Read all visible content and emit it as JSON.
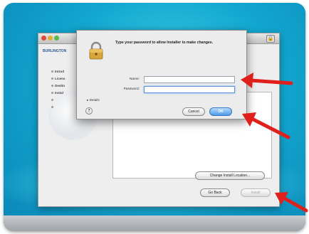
{
  "installer": {
    "brand": "BURLINGTON",
    "steps": [
      {
        "label": "Introd",
        "active": true
      },
      {
        "label": "Licens",
        "active": true
      },
      {
        "label": "Destin",
        "active": true
      },
      {
        "label": "Instal",
        "active": true
      },
      {
        "label": "",
        "active": false
      },
      {
        "label": "",
        "active": false
      }
    ],
    "change_location_button": "Change Install Location...",
    "go_back_button": "Go Back",
    "install_button": "Install"
  },
  "auth_dialog": {
    "message": "Type your password to allow Installer to make changes.",
    "name_label": "Name:",
    "password_label": "Password:",
    "name_value": "",
    "password_value": "",
    "details_label": "Details",
    "help_label": "?",
    "cancel_button": "Cancel",
    "ok_button": "OK"
  },
  "colors": {
    "background_gradient": "#12a7cf",
    "arrow": "#e0201a",
    "ok_button": "#4c9ae8"
  },
  "icons": [
    "lock-icon",
    "help-icon",
    "arrow-icon"
  ]
}
